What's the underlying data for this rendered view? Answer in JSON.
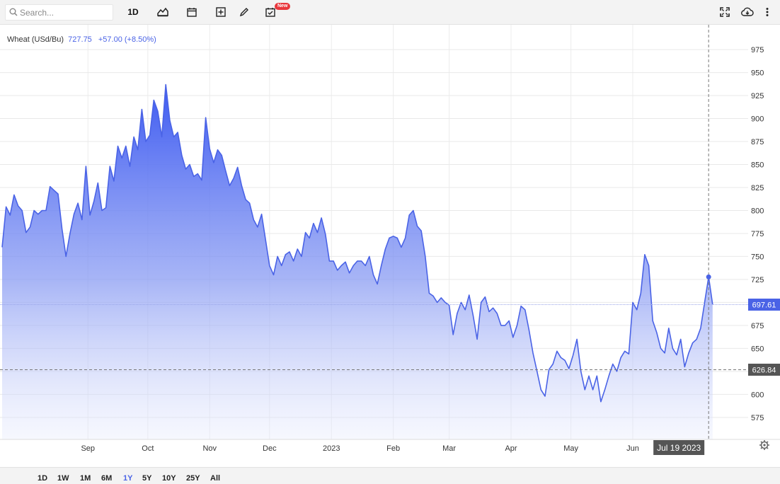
{
  "toolbar": {
    "search_placeholder": "Search...",
    "interval_label": "1D",
    "new_badge": "New",
    "icons": [
      "search-icon",
      "chart-type-icon",
      "calendar-icon",
      "add-indicator-icon",
      "draw-icon",
      "events-icon",
      "fullscreen-icon",
      "download-icon",
      "more-icon"
    ]
  },
  "legend": {
    "name": "Wheat (USd/Bu)",
    "value": "727.75",
    "change": "+57.00 (+8.50%)"
  },
  "crosshair": {
    "date_label": "Jul 19 2023",
    "value_label": "626.84",
    "value": 626.84
  },
  "last_price_label": "697.61",
  "range_buttons": [
    "1D",
    "1W",
    "1M",
    "6M",
    "1Y",
    "5Y",
    "10Y",
    "25Y",
    "All"
  ],
  "active_range": "1Y",
  "colors": {
    "line": "#4a63e6",
    "fill_top": "#3d5af1",
    "last_box": "#4a63e6",
    "crosshair_box": "#555555"
  },
  "chart_data": {
    "type": "area",
    "series": [
      {
        "name": "Wheat (USd/Bu)"
      }
    ],
    "y_ticks": [
      575,
      600,
      625,
      650,
      675,
      700,
      725,
      750,
      775,
      800,
      825,
      850,
      875,
      900,
      925,
      950,
      975
    ],
    "y_tick_labels": [
      "575",
      "600",
      "",
      "650",
      "675",
      "",
      "725",
      "750",
      "775",
      "800",
      "825",
      "850",
      "875",
      "900",
      "925",
      "950",
      "975"
    ],
    "ylim": [
      551,
      1002
    ],
    "x_ticks": [
      {
        "label": "Sep",
        "date": "2022-09-01"
      },
      {
        "label": "Oct",
        "date": "2022-10-01"
      },
      {
        "label": "Nov",
        "date": "2022-11-01"
      },
      {
        "label": "Dec",
        "date": "2022-12-01"
      },
      {
        "label": "2023",
        "date": "2023-01-01"
      },
      {
        "label": "Feb",
        "date": "2023-02-01"
      },
      {
        "label": "Mar",
        "date": "2023-03-01"
      },
      {
        "label": "Apr",
        "date": "2023-04-01"
      },
      {
        "label": "May",
        "date": "2023-05-01"
      },
      {
        "label": "Jun",
        "date": "2023-06-01"
      }
    ],
    "x_range": [
      "2022-07-20",
      "2023-07-21"
    ],
    "grid": true,
    "points": [
      [
        "2022-07-20",
        760
      ],
      [
        "2022-07-22",
        804
      ],
      [
        "2022-07-24",
        795
      ],
      [
        "2022-07-26",
        817
      ],
      [
        "2022-07-28",
        805
      ],
      [
        "2022-07-30",
        800
      ],
      [
        "2022-08-01",
        776
      ],
      [
        "2022-08-03",
        782
      ],
      [
        "2022-08-05",
        800
      ],
      [
        "2022-08-07",
        796
      ],
      [
        "2022-08-09",
        800
      ],
      [
        "2022-08-11",
        800
      ],
      [
        "2022-08-13",
        826
      ],
      [
        "2022-08-15",
        822
      ],
      [
        "2022-08-17",
        818
      ],
      [
        "2022-08-19",
        780
      ],
      [
        "2022-08-21",
        750
      ],
      [
        "2022-08-23",
        775
      ],
      [
        "2022-08-25",
        796
      ],
      [
        "2022-08-27",
        808
      ],
      [
        "2022-08-29",
        790
      ],
      [
        "2022-08-31",
        848
      ],
      [
        "2022-09-02",
        795
      ],
      [
        "2022-09-04",
        810
      ],
      [
        "2022-09-06",
        830
      ],
      [
        "2022-09-08",
        800
      ],
      [
        "2022-09-10",
        803
      ],
      [
        "2022-09-12",
        848
      ],
      [
        "2022-09-14",
        832
      ],
      [
        "2022-09-16",
        870
      ],
      [
        "2022-09-18",
        857
      ],
      [
        "2022-09-20",
        870
      ],
      [
        "2022-09-22",
        848
      ],
      [
        "2022-09-24",
        880
      ],
      [
        "2022-09-26",
        866
      ],
      [
        "2022-09-28",
        910
      ],
      [
        "2022-09-30",
        875
      ],
      [
        "2022-10-02",
        882
      ],
      [
        "2022-10-04",
        920
      ],
      [
        "2022-10-06",
        908
      ],
      [
        "2022-10-08",
        880
      ],
      [
        "2022-10-10",
        937
      ],
      [
        "2022-10-12",
        898
      ],
      [
        "2022-10-14",
        880
      ],
      [
        "2022-10-16",
        885
      ],
      [
        "2022-10-18",
        860
      ],
      [
        "2022-10-20",
        845
      ],
      [
        "2022-10-22",
        850
      ],
      [
        "2022-10-24",
        837
      ],
      [
        "2022-10-26",
        840
      ],
      [
        "2022-10-28",
        833
      ],
      [
        "2022-10-30",
        901
      ],
      [
        "2022-11-01",
        867
      ],
      [
        "2022-11-03",
        852
      ],
      [
        "2022-11-05",
        866
      ],
      [
        "2022-11-07",
        860
      ],
      [
        "2022-11-09",
        843
      ],
      [
        "2022-11-11",
        827
      ],
      [
        "2022-11-13",
        835
      ],
      [
        "2022-11-15",
        847
      ],
      [
        "2022-11-17",
        827
      ],
      [
        "2022-11-19",
        812
      ],
      [
        "2022-11-21",
        808
      ],
      [
        "2022-11-23",
        790
      ],
      [
        "2022-11-25",
        782
      ],
      [
        "2022-11-27",
        796
      ],
      [
        "2022-11-29",
        768
      ],
      [
        "2022-12-01",
        740
      ],
      [
        "2022-12-03",
        730
      ],
      [
        "2022-12-05",
        750
      ],
      [
        "2022-12-07",
        740
      ],
      [
        "2022-12-09",
        752
      ],
      [
        "2022-12-11",
        755
      ],
      [
        "2022-12-13",
        745
      ],
      [
        "2022-12-15",
        758
      ],
      [
        "2022-12-17",
        750
      ],
      [
        "2022-12-19",
        776
      ],
      [
        "2022-12-21",
        770
      ],
      [
        "2022-12-23",
        786
      ],
      [
        "2022-12-25",
        776
      ],
      [
        "2022-12-27",
        792
      ],
      [
        "2022-12-29",
        774
      ],
      [
        "2022-12-31",
        745
      ],
      [
        "2023-01-02",
        745
      ],
      [
        "2023-01-04",
        735
      ],
      [
        "2023-01-06",
        740
      ],
      [
        "2023-01-08",
        744
      ],
      [
        "2023-01-10",
        732
      ],
      [
        "2023-01-12",
        740
      ],
      [
        "2023-01-14",
        745
      ],
      [
        "2023-01-16",
        745
      ],
      [
        "2023-01-18",
        740
      ],
      [
        "2023-01-20",
        750
      ],
      [
        "2023-01-22",
        730
      ],
      [
        "2023-01-24",
        720
      ],
      [
        "2023-01-26",
        740
      ],
      [
        "2023-01-28",
        758
      ],
      [
        "2023-01-30",
        770
      ],
      [
        "2023-02-01",
        772
      ],
      [
        "2023-02-03",
        770
      ],
      [
        "2023-02-05",
        760
      ],
      [
        "2023-02-07",
        770
      ],
      [
        "2023-02-09",
        795
      ],
      [
        "2023-02-11",
        800
      ],
      [
        "2023-02-13",
        783
      ],
      [
        "2023-02-15",
        778
      ],
      [
        "2023-02-17",
        750
      ],
      [
        "2023-02-19",
        710
      ],
      [
        "2023-02-21",
        707
      ],
      [
        "2023-02-23",
        700
      ],
      [
        "2023-02-25",
        705
      ],
      [
        "2023-02-27",
        700
      ],
      [
        "2023-03-01",
        697
      ],
      [
        "2023-03-03",
        665
      ],
      [
        "2023-03-05",
        688
      ],
      [
        "2023-03-07",
        700
      ],
      [
        "2023-03-09",
        692
      ],
      [
        "2023-03-11",
        708
      ],
      [
        "2023-03-13",
        686
      ],
      [
        "2023-03-15",
        660
      ],
      [
        "2023-03-17",
        700
      ],
      [
        "2023-03-19",
        706
      ],
      [
        "2023-03-21",
        690
      ],
      [
        "2023-03-23",
        694
      ],
      [
        "2023-03-25",
        688
      ],
      [
        "2023-03-27",
        675
      ],
      [
        "2023-03-29",
        675
      ],
      [
        "2023-03-31",
        680
      ],
      [
        "2023-04-02",
        662
      ],
      [
        "2023-04-04",
        675
      ],
      [
        "2023-04-06",
        696
      ],
      [
        "2023-04-08",
        692
      ],
      [
        "2023-04-10",
        670
      ],
      [
        "2023-04-12",
        645
      ],
      [
        "2023-04-14",
        625
      ],
      [
        "2023-04-16",
        605
      ],
      [
        "2023-04-18",
        598
      ],
      [
        "2023-04-20",
        627
      ],
      [
        "2023-04-22",
        633
      ],
      [
        "2023-04-24",
        647
      ],
      [
        "2023-04-26",
        640
      ],
      [
        "2023-04-28",
        637
      ],
      [
        "2023-04-30",
        628
      ],
      [
        "2023-05-02",
        642
      ],
      [
        "2023-05-04",
        660
      ],
      [
        "2023-05-06",
        625
      ],
      [
        "2023-05-08",
        605
      ],
      [
        "2023-05-10",
        620
      ],
      [
        "2023-05-12",
        605
      ],
      [
        "2023-05-14",
        620
      ],
      [
        "2023-05-16",
        592
      ],
      [
        "2023-05-18",
        605
      ],
      [
        "2023-05-20",
        620
      ],
      [
        "2023-05-22",
        633
      ],
      [
        "2023-05-24",
        625
      ],
      [
        "2023-05-26",
        640
      ],
      [
        "2023-05-28",
        647
      ],
      [
        "2023-05-30",
        644
      ],
      [
        "2023-06-01",
        700
      ],
      [
        "2023-06-03",
        692
      ],
      [
        "2023-06-05",
        710
      ],
      [
        "2023-06-07",
        752
      ],
      [
        "2023-06-09",
        740
      ],
      [
        "2023-06-11",
        680
      ],
      [
        "2023-06-13",
        667
      ],
      [
        "2023-06-15",
        650
      ],
      [
        "2023-06-17",
        645
      ],
      [
        "2023-06-19",
        672
      ],
      [
        "2023-06-21",
        650
      ],
      [
        "2023-06-23",
        643
      ],
      [
        "2023-06-25",
        660
      ],
      [
        "2023-06-27",
        630
      ],
      [
        "2023-06-29",
        645
      ],
      [
        "2023-07-01",
        656
      ],
      [
        "2023-07-03",
        660
      ],
      [
        "2023-07-05",
        672
      ],
      [
        "2023-07-07",
        700
      ],
      [
        "2023-07-09",
        727.75
      ],
      [
        "2023-07-11",
        697.61
      ]
    ]
  }
}
